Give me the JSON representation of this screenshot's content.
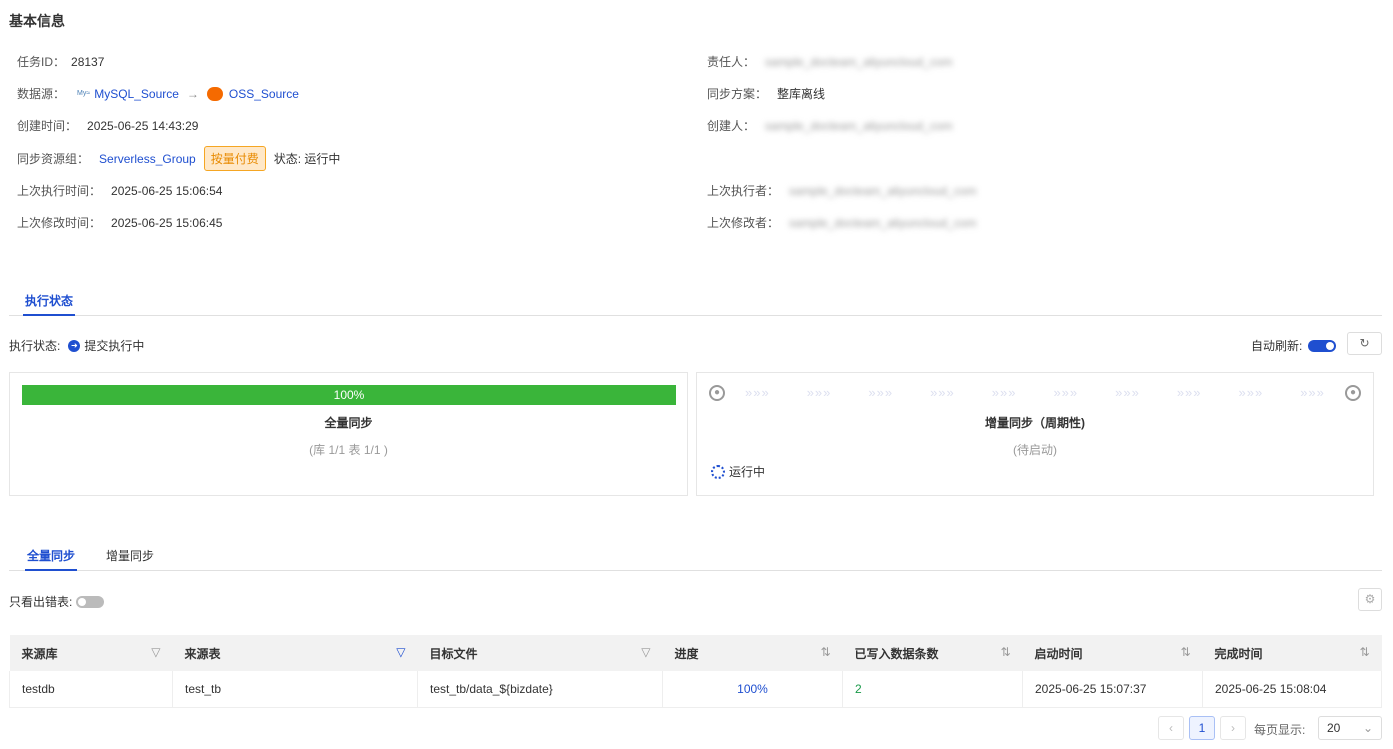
{
  "section_title": "基本信息",
  "info": {
    "task_id_label": "任务ID：",
    "task_id": "28137",
    "datasource_label": "数据源：",
    "source": "MySQL_Source",
    "target": "OSS_Source",
    "created_label": "创建时间：",
    "created": "2025-06-25 14:43:29",
    "resource_group_label": "同步资源组：",
    "resource_group": "Serverless_Group",
    "billing_tag": "按量付费",
    "status_text": "状态: 运行中",
    "last_run_label": "上次执行时间：",
    "last_run": "2025-06-25 15:06:54",
    "last_modified_label": "上次修改时间：",
    "last_modified": "2025-06-25 15:06:45",
    "owner_label": "责任人：",
    "owner": "sample_docteam_aliyuncloud_com",
    "plan_label": "同步方案：",
    "plan": "整库离线",
    "creator_label": "创建人：",
    "creator": "sample_docteam_aliyuncloud_com",
    "last_runner_label": "上次执行者：",
    "last_runner": "sample_docteam_aliyuncloud_com",
    "last_modifier_label": "上次修改者：",
    "last_modifier": "sample_docteam_aliyuncloud_com"
  },
  "exec_tab": "执行状态",
  "exec": {
    "status_label": "执行状态:",
    "status": "提交执行中",
    "auto_refresh_label": "自动刷新:",
    "auto_refresh": true
  },
  "full_sync": {
    "progress": "100%",
    "progress_value": 100,
    "title": "全量同步",
    "detail": "(库 1/1 表 1/1 )"
  },
  "incr_sync": {
    "title": "增量同步（周期性)",
    "detail": "(待启动)",
    "running": "运行中"
  },
  "detail_tabs": [
    "全量同步",
    "增量同步"
  ],
  "error_only_label": "只看出错表:",
  "table": {
    "columns": [
      "来源库",
      "来源表",
      "目标文件",
      "进度",
      "已写入数据条数",
      "启动时间",
      "完成时间"
    ],
    "rows": [
      [
        "testdb",
        "test_tb",
        "test_tb/data_${bizdate}",
        "100%",
        "2",
        "2025-06-25 15:07:37",
        "2025-06-25 15:08:04"
      ]
    ]
  },
  "pagination": {
    "prev": "‹",
    "page": "1",
    "next": "›",
    "page_size_label": "每页显示:",
    "page_size": "20"
  },
  "colors": {
    "accent": "#1f4fd0",
    "progress": "#3ab53a",
    "tag": "#f5a623"
  }
}
